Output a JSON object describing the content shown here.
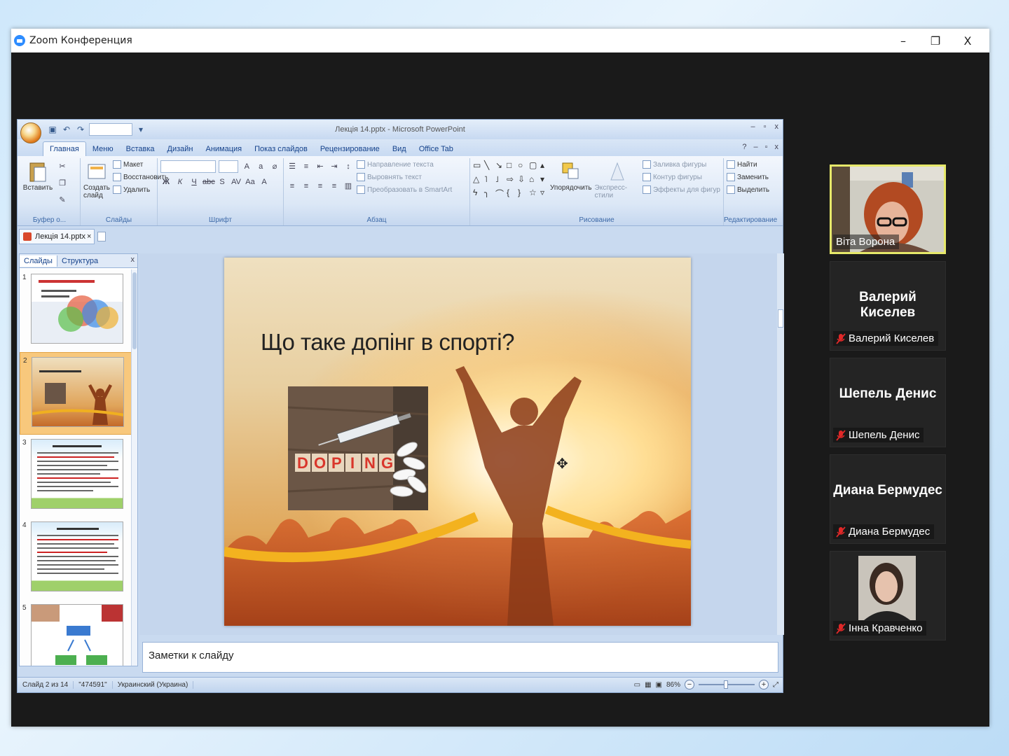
{
  "zoom": {
    "title": "Zoom Конференция",
    "controls": {
      "minimize": "–",
      "restore": "❐",
      "close": "X"
    }
  },
  "ppt": {
    "window_title": "Лекція 14.pptx - Microsoft PowerPoint",
    "tabs": [
      "Главная",
      "Меню",
      "Вставка",
      "Дизайн",
      "Анимация",
      "Показ слайдов",
      "Рецензирование",
      "Вид",
      "Office Tab"
    ],
    "ribbon": {
      "clipboard": {
        "paste": "Вставить",
        "label": "Буфер о..."
      },
      "slides": {
        "new_slide": "Создать слайд",
        "layout": "Макет",
        "reset": "Восстановить",
        "delete": "Удалить",
        "label": "Слайды"
      },
      "font": {
        "label": "Шрифт"
      },
      "paragraph": {
        "text_direction": "Направление текста",
        "align_text": "Выровнять текст",
        "smartart": "Преобразовать в SmartArt",
        "label": "Абзац"
      },
      "drawing": {
        "arrange": "Упорядочить",
        "quick_styles": "Экспресс-стили",
        "fill": "Заливка фигуры",
        "outline": "Контур фигуры",
        "effects": "Эффекты для фигур",
        "label": "Рисование"
      },
      "editing": {
        "find": "Найти",
        "replace": "Заменить",
        "select": "Выделить",
        "label": "Редактирование"
      }
    },
    "doc_tab": "Лекція 14.pptx",
    "pane_tabs": [
      "Слайды",
      "Структура"
    ],
    "thumbnails": [
      "1",
      "2",
      "3",
      "4",
      "5"
    ],
    "slide": {
      "title": "Що таке допінг в спорті?",
      "doping_letters": [
        "D",
        "O",
        "P",
        "I",
        "N",
        "G"
      ]
    },
    "notes_placeholder": "Заметки к слайду",
    "status": {
      "slide": "Слайд 2 из 14",
      "theme": "\"474591\"",
      "language": "Украинский (Украина)",
      "zoom": "86%"
    }
  },
  "participants": [
    {
      "name": "Віта Ворона",
      "active": true,
      "video": true
    },
    {
      "name": "Валерий Киселев",
      "muted": true
    },
    {
      "name": "Шепель Денис",
      "muted": true
    },
    {
      "name": "Диана Бермудес",
      "muted": true
    },
    {
      "name": "Інна Кравченко",
      "muted": true,
      "video": true
    }
  ]
}
